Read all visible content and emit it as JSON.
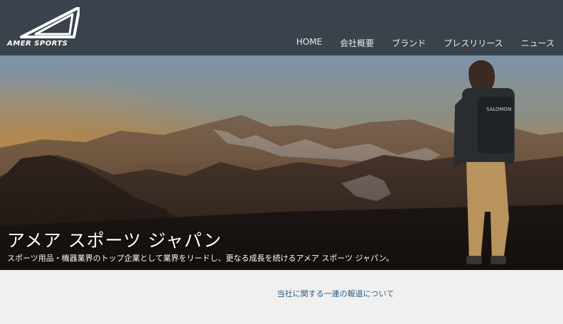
{
  "brand": {
    "name": "AMER SPORTS"
  },
  "nav": {
    "items": [
      {
        "label": "HOME"
      },
      {
        "label": "会社概要"
      },
      {
        "label": "ブランド"
      },
      {
        "label": "プレスリリース"
      },
      {
        "label": "ニュース"
      }
    ]
  },
  "hero": {
    "title": "アメア スポーツ ジャパン",
    "subtitle": "スポーツ用品・機器業界のトップ企業として業界をリードし、更なる成長を続けるアメア スポーツ ジャパン。",
    "backpack_text": "SALOMON"
  },
  "notice": {
    "link_text": "当社に関する一連の報道について"
  },
  "colors": {
    "header_bg": "#3a434c",
    "link": "#2f5d86",
    "page_bg": "#f0f0f0"
  }
}
